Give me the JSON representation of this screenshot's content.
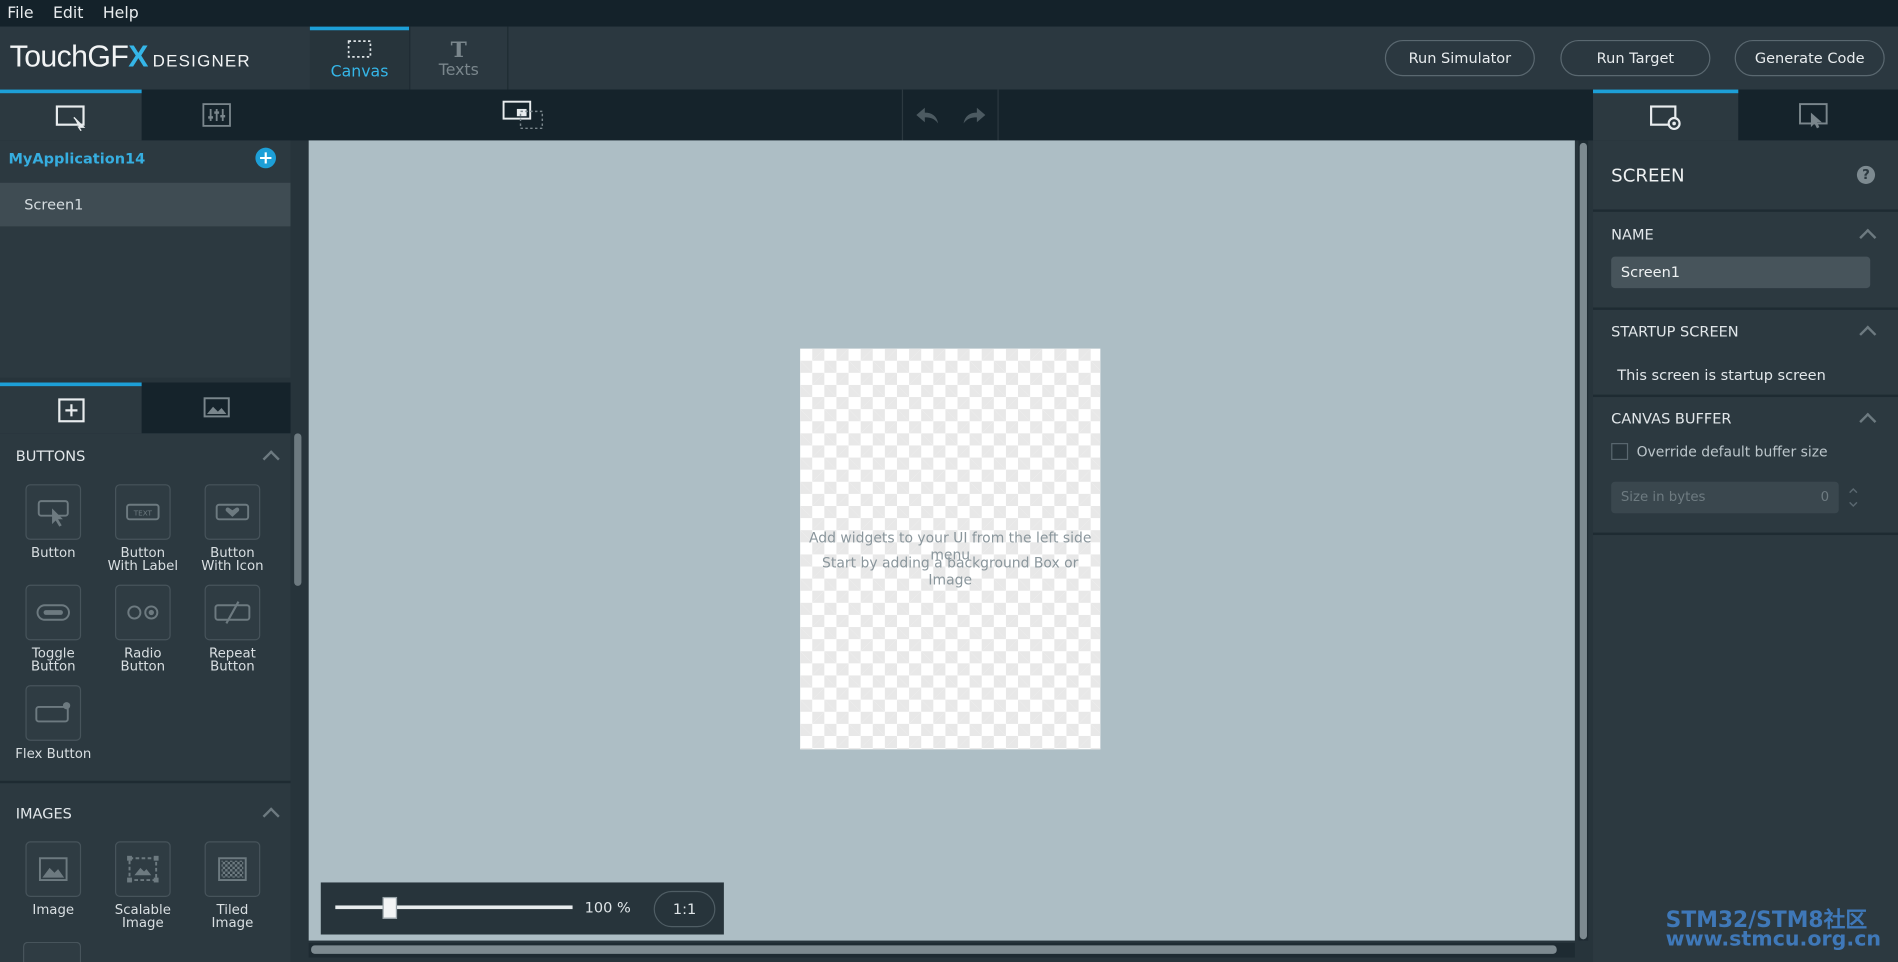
{
  "menu": {
    "file": "File",
    "edit": "Edit",
    "help": "Help"
  },
  "logo": {
    "touch": "TouchGF",
    "x": "X",
    "designer": "DESIGNER"
  },
  "main_tabs": {
    "canvas": "Canvas",
    "texts": "Texts"
  },
  "header_buttons": {
    "run_simulator": "Run Simulator",
    "run_target": "Run Target",
    "generate_code": "Generate Code"
  },
  "tree": {
    "app_name": "MyApplication14",
    "screens": [
      "Screen1"
    ]
  },
  "widgets": {
    "buttons_title": "BUTTONS",
    "buttons": [
      {
        "line1": "Button",
        "line2": ""
      },
      {
        "line1": "Button",
        "line2": "With Label"
      },
      {
        "line1": "Button",
        "line2": "With Icon"
      },
      {
        "line1": "Toggle",
        "line2": "Button"
      },
      {
        "line1": "Radio",
        "line2": "Button"
      },
      {
        "line1": "Repeat",
        "line2": "Button"
      },
      {
        "line1": "Flex Button",
        "line2": ""
      }
    ],
    "button_icon_text": "TEXT",
    "images_title": "IMAGES",
    "images": [
      {
        "line1": "Image",
        "line2": ""
      },
      {
        "line1": "Scalable",
        "line2": "Image"
      },
      {
        "line1": "Tiled",
        "line2": "Image"
      }
    ]
  },
  "canvas": {
    "hint1": "Add widgets to your UI from the left side menu",
    "hint2": "Start by adding a background Box or Image"
  },
  "zoom": {
    "label": "100 %",
    "ratio_button": "1:1",
    "level_percent": 100
  },
  "properties": {
    "title": "SCREEN",
    "help": "?",
    "name_title": "NAME",
    "name_value": "Screen1",
    "startup_title": "STARTUP SCREEN",
    "startup_text": "This screen is startup screen",
    "buffer_title": "CANVAS BUFFER",
    "override_label": "Override default buffer size",
    "size_placeholder": "Size in bytes",
    "size_value": "0"
  },
  "watermark": {
    "line1": "STM32/STM8社区",
    "line2": "www.stmcu.org.cn"
  },
  "colors": {
    "accent": "#35b6e8",
    "header": "#2b3840",
    "canvas_bg": "#adbec5"
  }
}
